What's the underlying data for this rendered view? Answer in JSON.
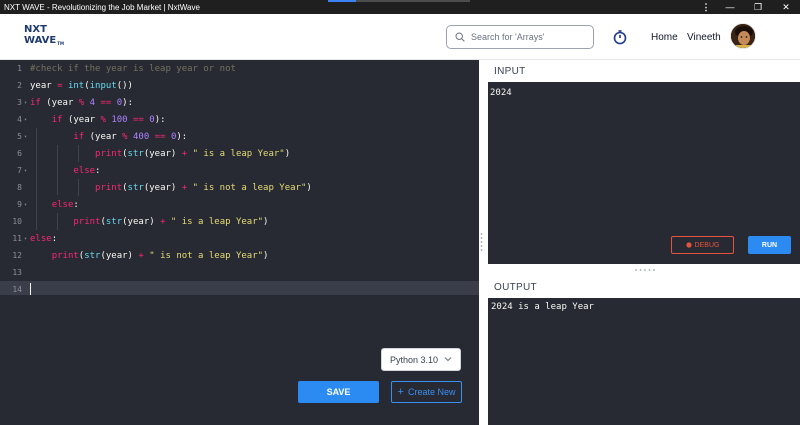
{
  "window": {
    "title": "NXT WAVE - Revolutionizing the Job Market | NxtWave",
    "controls": {
      "menu": "⋮",
      "minimize": "—",
      "restore": "❐",
      "close": "✕"
    }
  },
  "header": {
    "logo_line1": "NXT",
    "logo_line2": "WAVE",
    "logo_tm": "TM",
    "search_placeholder": "Search for 'Arrays'",
    "home_label": "Home",
    "user_name": "Vineeth"
  },
  "editor": {
    "lines": [
      {
        "num": "1",
        "fold": ""
      },
      {
        "num": "2",
        "fold": ""
      },
      {
        "num": "3",
        "fold": "▾"
      },
      {
        "num": "4",
        "fold": "▾"
      },
      {
        "num": "5",
        "fold": "▾"
      },
      {
        "num": "6",
        "fold": ""
      },
      {
        "num": "7",
        "fold": "▾"
      },
      {
        "num": "8",
        "fold": ""
      },
      {
        "num": "9",
        "fold": "▾"
      },
      {
        "num": "10",
        "fold": ""
      },
      {
        "num": "11",
        "fold": "▾"
      },
      {
        "num": "12",
        "fold": ""
      },
      {
        "num": "13",
        "fold": ""
      },
      {
        "num": "14",
        "fold": ""
      }
    ],
    "tokens": {
      "l1_comment": "#check if the year is leap year or not",
      "l2_var": "year ",
      "l2_eq": "= ",
      "l2_int": "int",
      "l2_p1": "(",
      "l2_input": "input",
      "l2_p2": "())",
      "l3_if": "if ",
      "l3_a": "(year ",
      "l3_mod": "% ",
      "l3_n4": "4 ",
      "l3_eqeq": "== ",
      "l3_n0": "0",
      "l3_b": "):",
      "l4_if": "if ",
      "l4_a": "(year ",
      "l4_mod": "% ",
      "l4_n100": "100 ",
      "l4_eqeq": "== ",
      "l4_n0": "0",
      "l4_b": "):",
      "l5_if": "if ",
      "l5_a": "(year ",
      "l5_mod": "% ",
      "l5_n400": "400 ",
      "l5_eqeq": "== ",
      "l5_n0": "0",
      "l5_b": "):",
      "l6_print": "print",
      "l6_p": "(",
      "l6_str": "str",
      "l6_a": "(year) ",
      "l6_plus": "+ ",
      "l6_s": "\" is a leap Year\"",
      "l6_b": ")",
      "l7_else": "else",
      "l7_c": ":",
      "l8_print": "print",
      "l8_p": "(",
      "l8_str": "str",
      "l8_a": "(year) ",
      "l8_plus": "+ ",
      "l8_s": "\" is not a leap Year\"",
      "l8_b": ")",
      "l9_else": "else",
      "l9_c": ":",
      "l10_print": "print",
      "l10_p": "(",
      "l10_str": "str",
      "l10_a": "(year) ",
      "l10_plus": "+ ",
      "l10_s": "\" is a leap Year\"",
      "l10_b": ")",
      "l11_else": "else",
      "l11_c": ":",
      "l12_print": "print",
      "l12_p": "(",
      "l12_str": "str",
      "l12_a": "(year) ",
      "l12_plus": "+ ",
      "l12_s": "\" is not a leap Year\"",
      "l12_b": ")"
    }
  },
  "controls": {
    "language": "Python 3.10",
    "save_label": "SAVE",
    "create_new_label": "Create New",
    "create_new_icon": "+"
  },
  "input_panel": {
    "heading": "INPUT",
    "value": "2024",
    "debug_label": "DEBUG",
    "run_label": "RUN"
  },
  "output_panel": {
    "heading": "OUTPUT",
    "text": "2024 is a leap Year"
  },
  "colors": {
    "editor_bg": "#272a33",
    "accent_blue": "#2b8bf2",
    "debug_red": "#e5533d",
    "keyword": "#f92672",
    "builtin": "#66d9ef",
    "number": "#ae81ff",
    "string": "#e6db74"
  }
}
